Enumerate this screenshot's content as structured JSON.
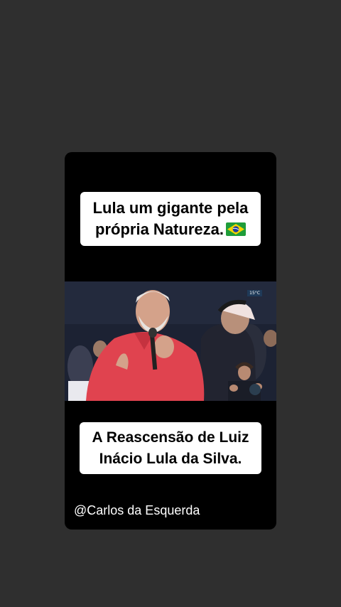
{
  "story": {
    "top_caption": "Lula um gigante pela própria Natureza.",
    "flag_icon": "brazil-flag-emoji",
    "bottom_caption": "A Reascensão de Luiz Inácio Lula da Silva.",
    "handle": "@Carlos da Esquerda",
    "video_overlay_badge": "15°C"
  },
  "colors": {
    "background": "#2f2f2f",
    "card": "#000000",
    "caption_bg": "#ffffff",
    "shirt": "#e0434f"
  }
}
